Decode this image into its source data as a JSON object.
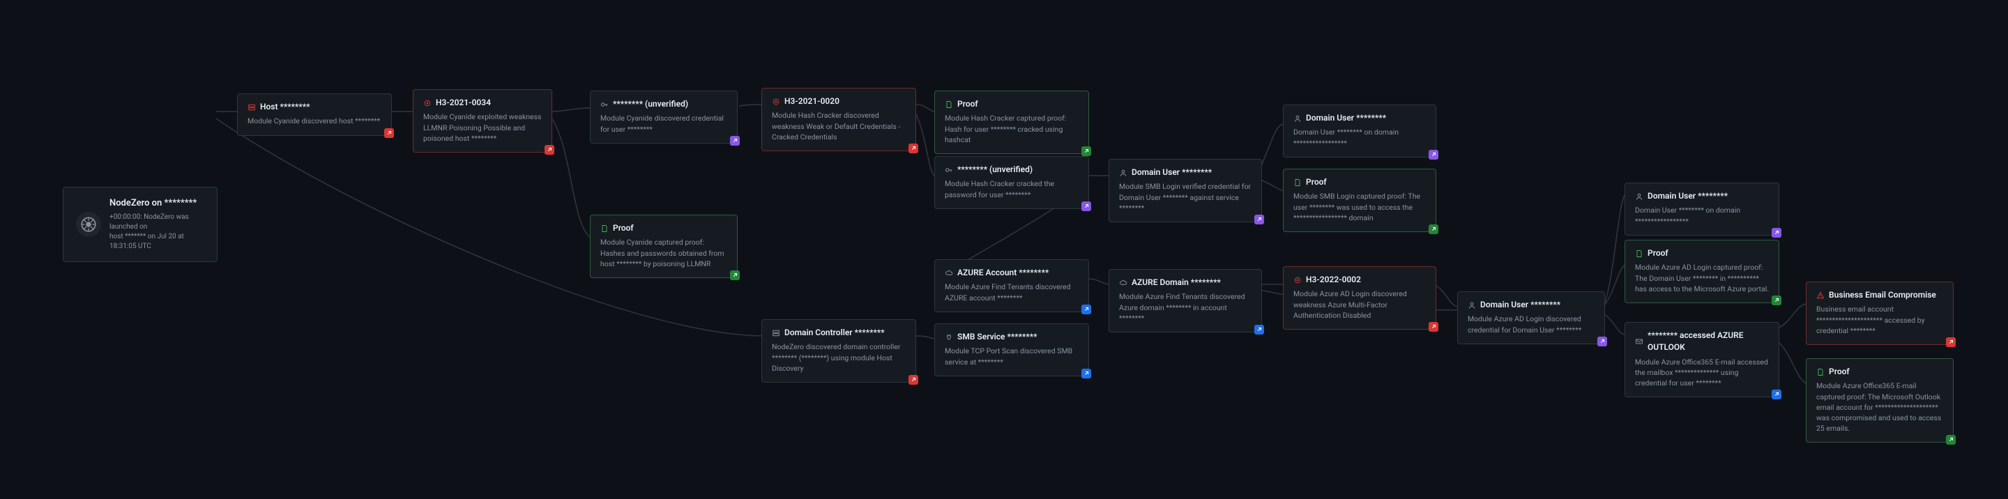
{
  "root": {
    "title": "NodeZero on ********",
    "meta1": "+00:00:00: NodeZero was launched on",
    "meta2": "host ******* on Jul 20 at 18:31:05 UTC"
  },
  "nodes": {
    "host": {
      "title": "Host ********",
      "body": "Module Cyanide discovered host ********"
    },
    "h3_2021_0034": {
      "title": "H3-2021-0034",
      "body": "Module Cyanide exploited weakness LLMNR Poisoning Possible and poisoned host ********"
    },
    "unverified1": {
      "title": "******** (unverified)",
      "body": "Module Cyanide discovered credential for user ********"
    },
    "h3_2021_0020": {
      "title": "H3-2021-0020",
      "body": "Module Hash Cracker discovered weakness Weak or Default Credentials - Cracked Credentials"
    },
    "proof1": {
      "title": "Proof",
      "body": "Module Hash Cracker captured proof: Hash for user ********  cracked using hashcat"
    },
    "unverified2": {
      "title": "******** (unverified)",
      "body": "Module Hash Cracker cracked the password for user ********"
    },
    "domainuser1": {
      "title": "Domain User ********",
      "body": "Module SMB Login verified credential for Domain User ******** against service ********"
    },
    "domainuser_top": {
      "title": "Domain User ********",
      "body": "Domain User ******** on domain  *****************"
    },
    "proof2": {
      "title": "Proof",
      "body": "Module SMB Login captured proof: The user ********  was used to access the  *****************  domain"
    },
    "proof_llmnr": {
      "title": "Proof",
      "body": "Module Cyanide captured proof: Hashes and passwords obtained from host ******** by poisoning LLMNR"
    },
    "azure_account": {
      "title": "AZURE Account ********",
      "body": "Module Azure Find Tenants discovered AZURE account ********"
    },
    "azure_domain": {
      "title": "AZURE Domain ********",
      "body": "Module Azure Find Tenants discovered Azure domain ******** in account ********"
    },
    "h3_2022_0002": {
      "title": "H3-2022-0002",
      "body": "Module Azure AD Login discovered weakness Azure Multi-Factor Authentication Disabled"
    },
    "domainuser2": {
      "title": "Domain User ********",
      "body": "Module Azure AD Login discovered credential for Domain User ********"
    },
    "domainuser_right": {
      "title": "Domain User ********",
      "body": "Domain User ******** on domain  *****************"
    },
    "proof_azad": {
      "title": "Proof",
      "body": "Module Azure AD Login captured proof: The Domain User ******** in  **********  has access to the Microsoft Azure portal."
    },
    "bec": {
      "title": "Business Email Compromise",
      "body": "Business email account  *********************  accessed by credential ********"
    },
    "outlook": {
      "title": "******** accessed AZURE OUTLOOK",
      "body": "Module Azure Office365 E-mail accessed the mailbox  **************  using credential for user ********"
    },
    "proof_o365": {
      "title": "Proof",
      "body": "Module Azure Office365 E-mail captured proof: The Microsoft Outlook email account for  ********************  was compromised and used to access 25 emails."
    },
    "dc": {
      "title": "Domain Controller ********",
      "body": "NodeZero discovered domain controller ******** (********) using module Host Discovery"
    },
    "smb": {
      "title": "SMB Service ********",
      "body": "Module TCP Port Scan discovered SMB service at ********"
    }
  }
}
